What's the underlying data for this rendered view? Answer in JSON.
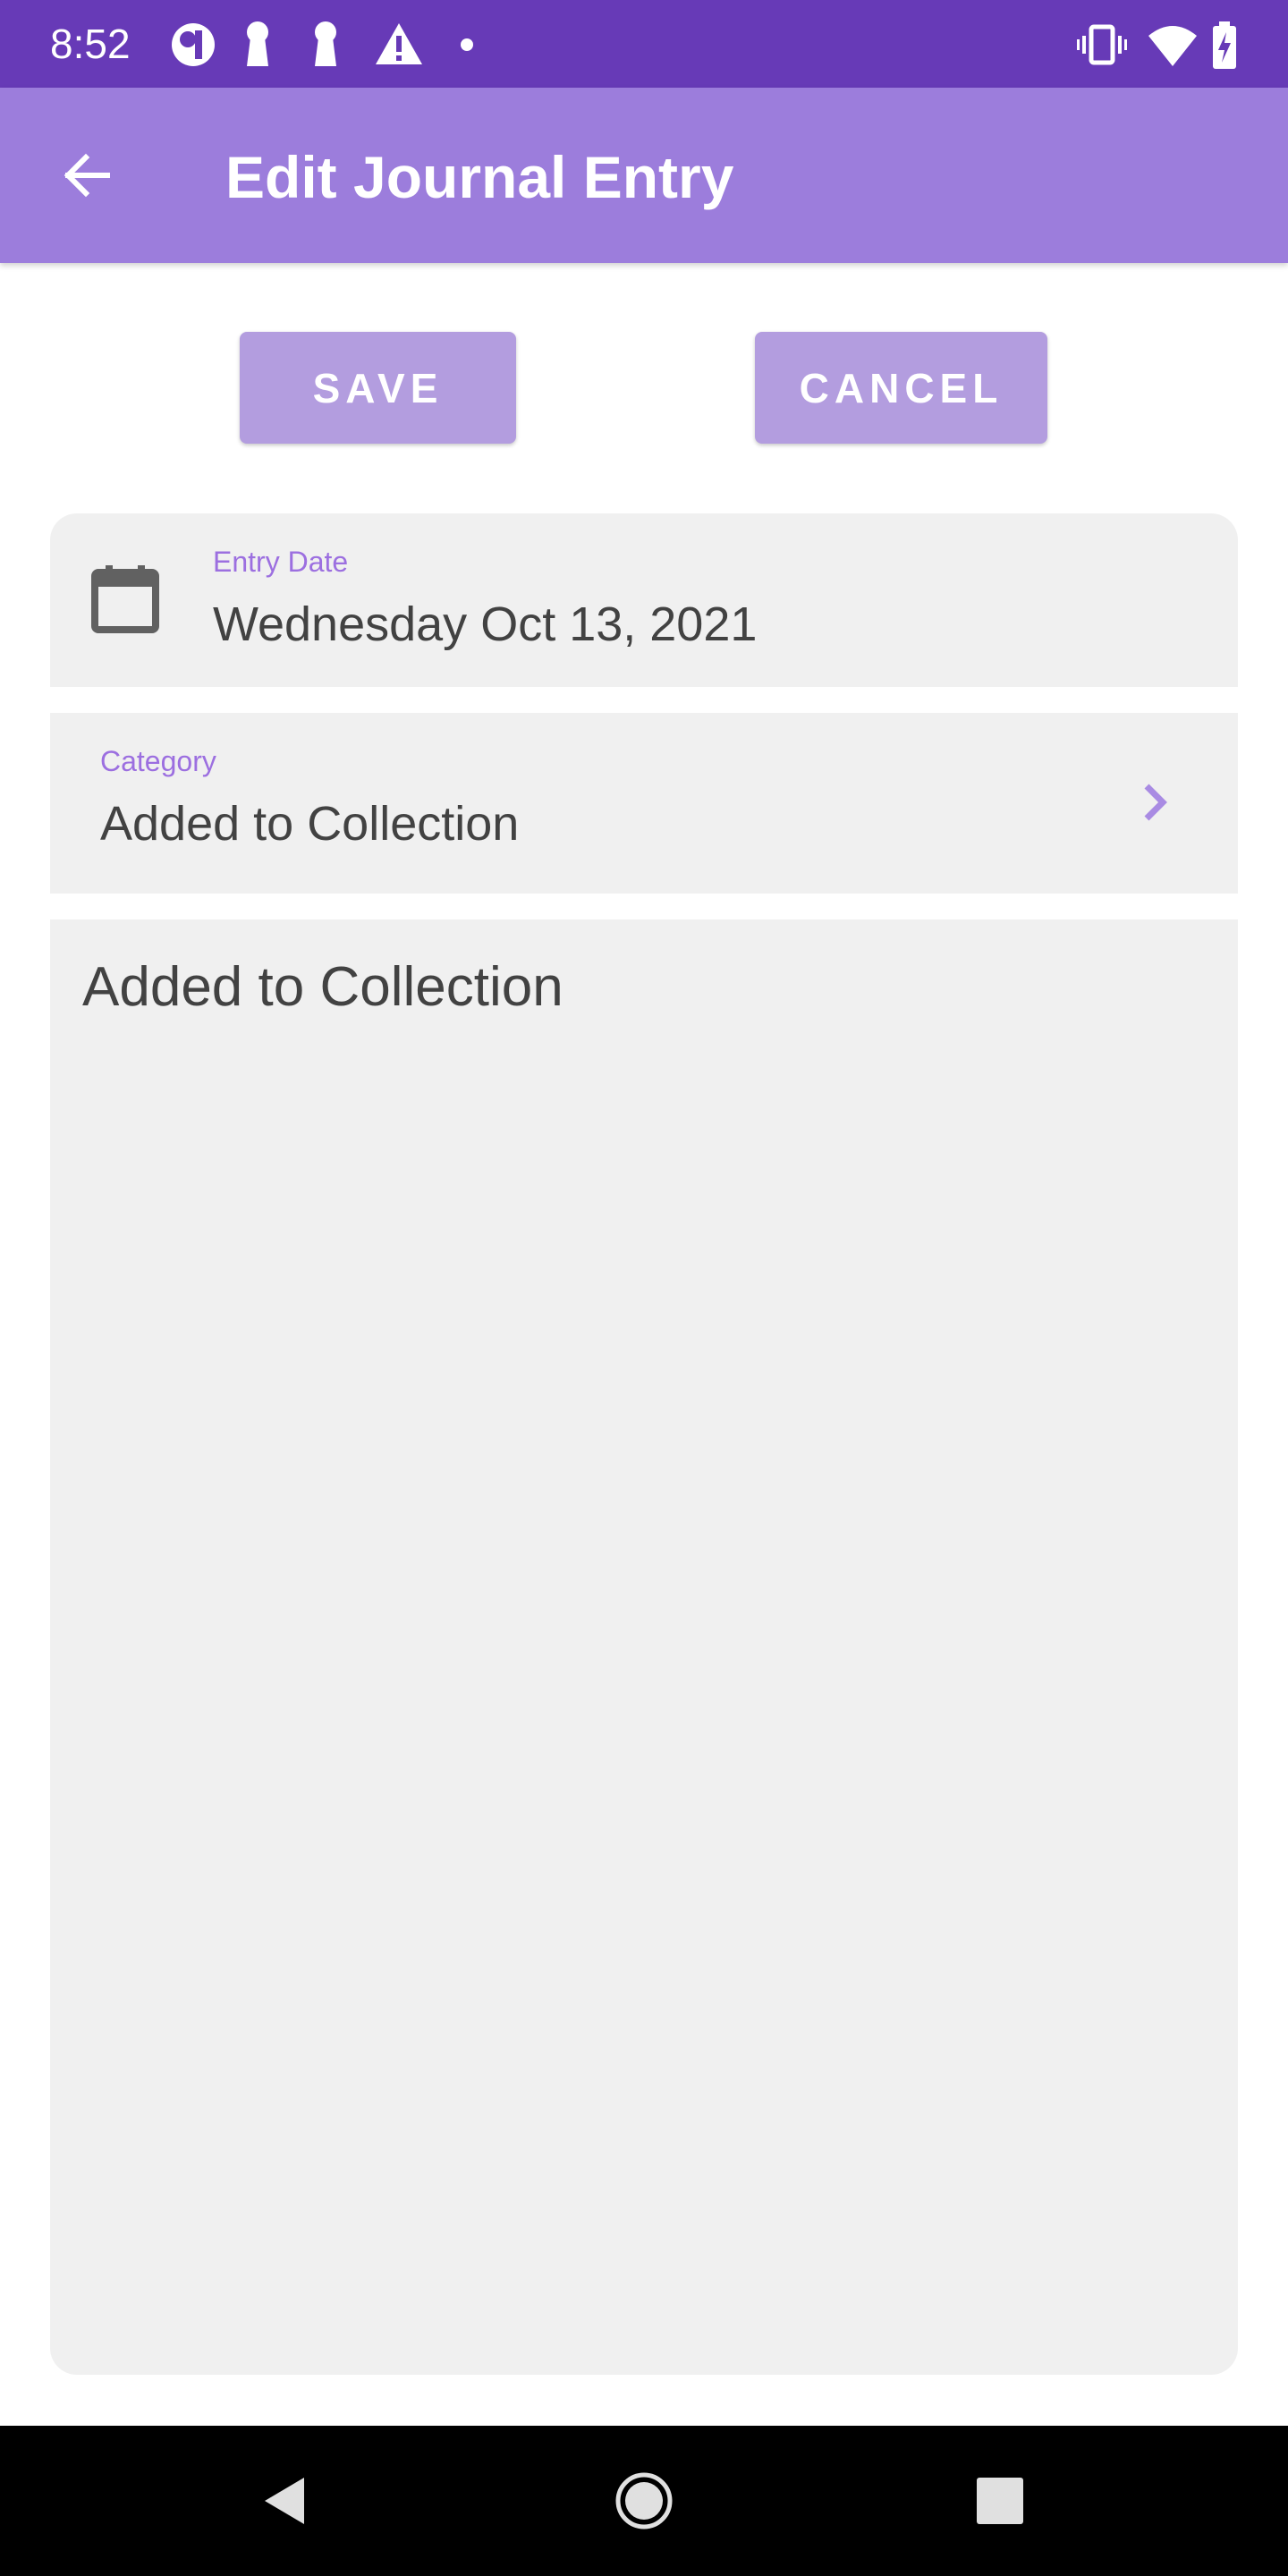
{
  "status_bar": {
    "time": "8:52",
    "left_icons": [
      "app-notification-icon",
      "keyhole-icon",
      "keyhole-icon",
      "warning-icon",
      "dot-icon"
    ],
    "right_icons": [
      "vibrate-icon",
      "wifi-icon",
      "battery-charging-icon"
    ]
  },
  "app_bar": {
    "back_icon": "arrow-back-icon",
    "title": "Edit Journal Entry"
  },
  "actions": {
    "save_label": "SAVE",
    "cancel_label": "CANCEL"
  },
  "entry_date": {
    "icon": "calendar-icon",
    "label": "Entry Date",
    "value": "Wednesday Oct 13, 2021"
  },
  "category": {
    "label": "Category",
    "value": "Added to Collection",
    "icon": "chevron-right-icon"
  },
  "notes": {
    "value": "Added to Collection"
  },
  "nav_bar": {
    "buttons": [
      "back-triangle-icon",
      "home-circle-icon",
      "recents-square-icon"
    ]
  },
  "colors": {
    "status_bar": "#673ab7",
    "app_bar": "#9c7ddc",
    "button": "#b39ddf",
    "label_accent": "#9c6fe0",
    "field_bg": "#f0f0f0",
    "text": "#424242"
  }
}
